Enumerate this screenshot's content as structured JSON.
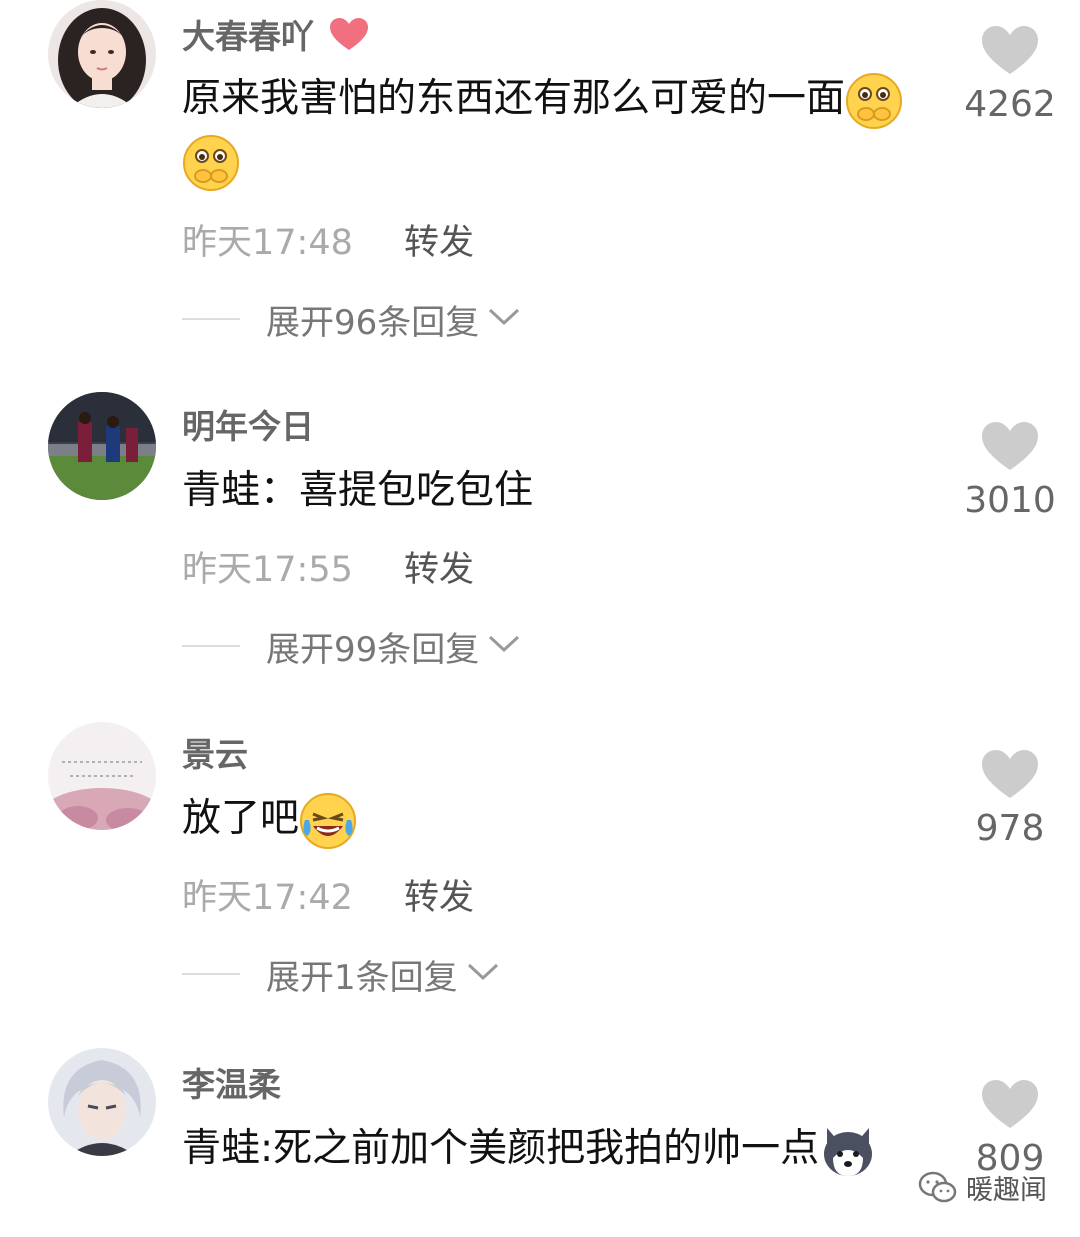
{
  "comments": [
    {
      "username": "大春春吖",
      "text": "原来我害怕的东西还有那么可爱的一面",
      "emojis": [
        "shy-face-emoji",
        "shy-face-emoji"
      ],
      "time": "昨天17:48",
      "repost": "转发",
      "expand": "展开96条回复",
      "likes": "4262",
      "has_heart_badge": true
    },
    {
      "username": "明年今日",
      "text": "青蛙：喜提包吃包住",
      "emojis": [],
      "time": "昨天17:55",
      "repost": "转发",
      "expand": "展开99条回复",
      "likes": "3010"
    },
    {
      "username": "景云",
      "text": "放了吧",
      "emojis": [
        "laughing-crying-emoji"
      ],
      "time": "昨天17:42",
      "repost": "转发",
      "expand": "展开1条回复",
      "likes": "978"
    },
    {
      "username": "李温柔",
      "text": "青蛙:死之前加个美颜把我拍的帅一点",
      "emojis": [
        "husky-dog-emoji"
      ],
      "likes": "809"
    }
  ],
  "watermark": {
    "text": "暖趣闻",
    "icon": "wechat-icon"
  },
  "colors": {
    "username": "#666666",
    "text": "#111111",
    "time": "#aaaaaa",
    "like_icon": "#cccccc",
    "heart_badge": "#f07080"
  }
}
